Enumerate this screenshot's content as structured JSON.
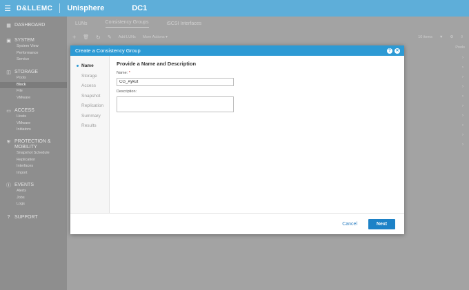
{
  "topbar": {
    "brand": "D&LLEMC",
    "app": "Unisphere",
    "system": "DC1"
  },
  "sidebar": {
    "sections": [
      {
        "label": "DASHBOARD",
        "items": []
      },
      {
        "label": "SYSTEM",
        "items": [
          "System View",
          "Performance",
          "Service"
        ]
      },
      {
        "label": "STORAGE",
        "items": [
          "Pools",
          "Block",
          "File",
          "VMware"
        ]
      },
      {
        "label": "ACCESS",
        "items": [
          "Hosts",
          "VMware",
          "Initiators"
        ]
      },
      {
        "label": "PROTECTION & MOBILITY",
        "items": [
          "Snapshot Schedule",
          "Replication",
          "Interfaces",
          "Import"
        ]
      },
      {
        "label": "EVENTS",
        "items": [
          "Alerts",
          "Jobs",
          "Logs"
        ]
      },
      {
        "label": "SUPPORT",
        "items": []
      }
    ],
    "active_item": "Block"
  },
  "main": {
    "tabs": [
      "LUNs",
      "Consistency Groups",
      "iSCSI Interfaces"
    ],
    "active_tab": "Consistency Groups",
    "toolbar": {
      "add_luns": "Add LUNs",
      "more_actions": "More Actions",
      "item_count": "10 items"
    },
    "column_header": "Pools"
  },
  "dialog": {
    "title": "Create a Consistency Group",
    "steps": [
      "Name",
      "Storage",
      "Access",
      "Snapshot",
      "Replication",
      "Summary",
      "Results"
    ],
    "current_step": "Name",
    "heading": "Provide a Name and Description",
    "name_label": "Name:",
    "required_mark": "*",
    "name_value": "CG_Aykut",
    "description_label": "Description:",
    "description_value": "",
    "cancel_label": "Cancel",
    "next_label": "Next"
  }
}
